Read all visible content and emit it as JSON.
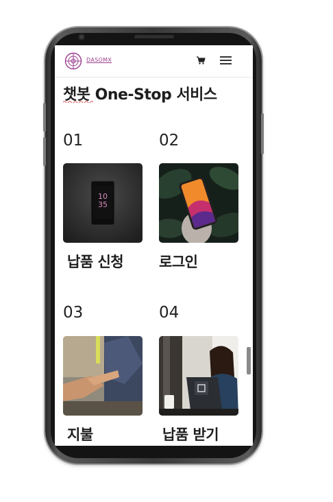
{
  "brand": {
    "name": "DASOMX",
    "accent": "#9b3d8f"
  },
  "header": {
    "icons": [
      "cart-icon",
      "hamburger-menu-icon"
    ]
  },
  "section": {
    "title": "챗봇 One-Stop 서비스"
  },
  "services": [
    {
      "number": "01",
      "label": "납품 신청",
      "image": "black smartphone on dark background"
    },
    {
      "number": "02",
      "label": "로그인",
      "image": "hand holding smartphone among leaves"
    },
    {
      "number": "03",
      "label": "지불",
      "image": "two hands passing"
    },
    {
      "number": "04",
      "label": "납품 받기",
      "image": "smiling woman at payment terminal"
    }
  ]
}
